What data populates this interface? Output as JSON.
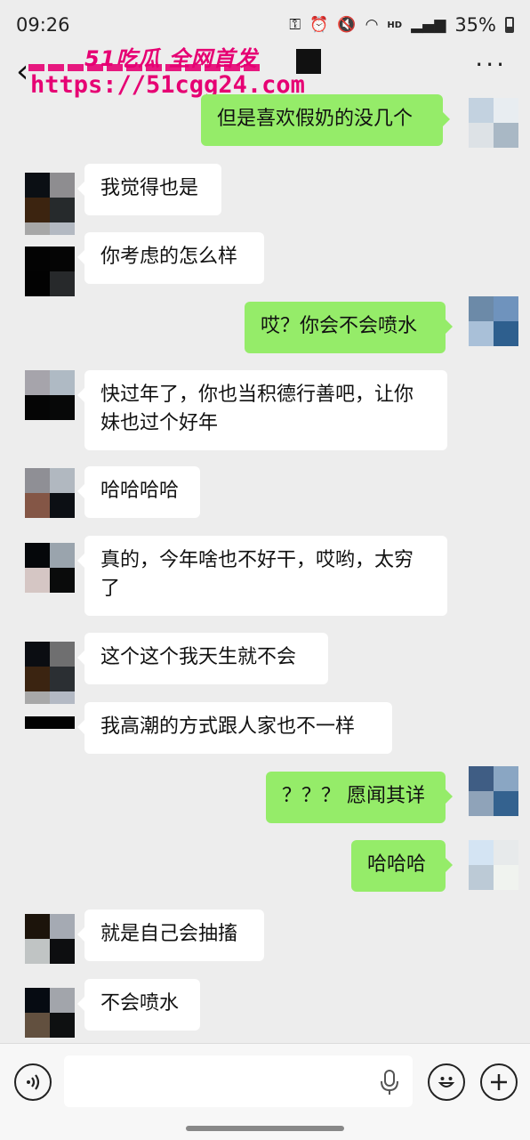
{
  "status_bar": {
    "time": "09:26",
    "battery": "35%",
    "hd_label": "HD"
  },
  "watermark": {
    "brand": "51吃瓜 全网首发",
    "url": "https://51cgg24.com"
  },
  "chat": {
    "messages": [
      {
        "side": "right",
        "text": "但是喜欢假奶的没几个"
      },
      {
        "side": "left",
        "text": "我觉得也是"
      },
      {
        "side": "left",
        "text": "你考虑的怎么样"
      },
      {
        "side": "right",
        "text": "哎？你会不会喷水"
      },
      {
        "side": "left",
        "text": "快过年了，你也当积德行善吧，让你妹也过个好年"
      },
      {
        "side": "left",
        "text": "哈哈哈哈"
      },
      {
        "side": "left",
        "text": "真的，今年啥也不好干，哎哟，太穷了"
      },
      {
        "side": "left",
        "text": "这个这个我天生就不会"
      },
      {
        "side": "left",
        "text": "我高潮的方式跟人家也不一样"
      },
      {
        "side": "right",
        "text": "？？？ 愿闻其详"
      },
      {
        "side": "right",
        "text": "哈哈哈"
      },
      {
        "side": "left",
        "text": "就是自己会抽搐"
      },
      {
        "side": "left",
        "text": "不会喷水"
      }
    ]
  },
  "input": {
    "placeholder": ""
  },
  "icons": {
    "voice": "voice-toggle-icon",
    "emoji": "emoji-icon",
    "add": "add-icon",
    "mic": "microphone-icon",
    "back": "back-arrow-icon",
    "more": "more-icon"
  },
  "colors": {
    "sent_bubble": "#95ec69",
    "received_bubble": "#ffffff",
    "background": "#ededed",
    "watermark": "#e60073"
  }
}
